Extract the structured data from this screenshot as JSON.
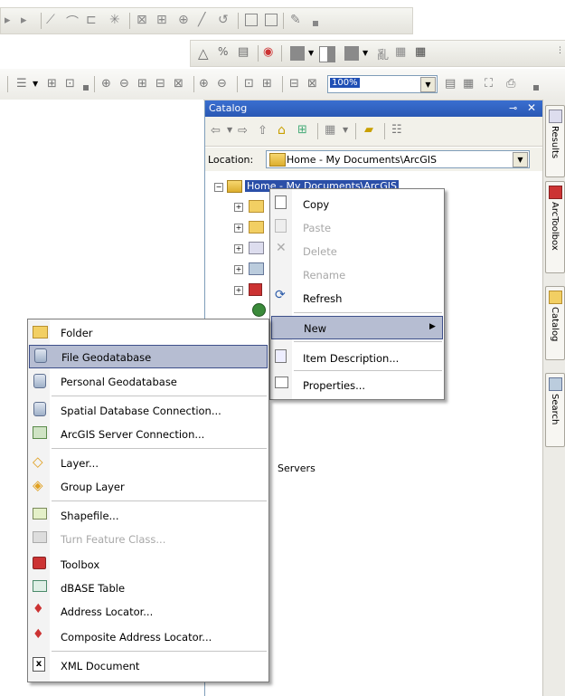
{
  "toolbars": {
    "zoom_value": "100%"
  },
  "catalog": {
    "title": "Catalog",
    "location_label": "Location:",
    "location_value": "Home - My Documents\\ArcGIS",
    "root_node": "Home - My Documents\\ArcGIS",
    "partial_label": "Servers"
  },
  "dock_tabs": [
    "Results",
    "ArcToolbox",
    "Catalog",
    "Search"
  ],
  "context_menu": {
    "items": [
      "Copy",
      "Paste",
      "Delete",
      "Rename",
      "Refresh",
      "New",
      "Item Description...",
      "Properties..."
    ],
    "disabled": [
      "Paste",
      "Delete",
      "Rename"
    ],
    "highlighted": "New"
  },
  "new_submenu": {
    "items": [
      "Folder",
      "File Geodatabase",
      "Personal Geodatabase",
      "Spatial Database Connection...",
      "ArcGIS Server Connection...",
      "Layer...",
      "Group Layer",
      "Shapefile...",
      "Turn Feature Class...",
      "Toolbox",
      "dBASE Table",
      "Address Locator...",
      "Composite Address Locator...",
      "XML Document"
    ],
    "disabled": [
      "Turn Feature Class..."
    ],
    "highlighted": "File Geodatabase"
  }
}
